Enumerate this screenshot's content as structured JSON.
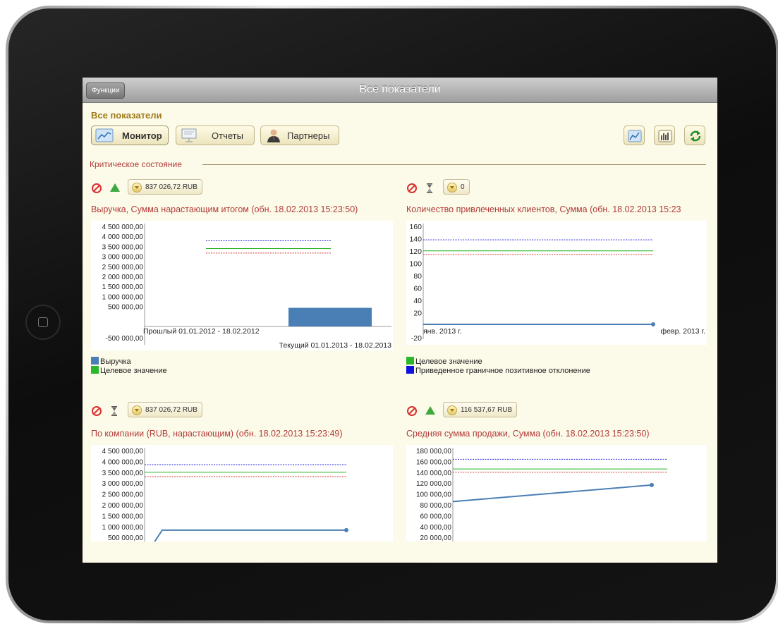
{
  "window": {
    "title": "Все показатели",
    "functions_button": "Функции"
  },
  "header": {
    "section_title": "Все показатели"
  },
  "nav": [
    {
      "label": "Монитор",
      "active": true,
      "icon": "monitor-chart-icon"
    },
    {
      "label": "Отчеты",
      "active": false,
      "icon": "presentation-board-icon"
    },
    {
      "label": "Партнеры",
      "active": false,
      "icon": "person-icon"
    }
  ],
  "toolbar_icons": [
    "line-chart-icon",
    "bar-chart-icon",
    "refresh-icon"
  ],
  "group": {
    "label": "Критическое состояние"
  },
  "colors": {
    "accent_red": "#b23a3a",
    "section_gold": "#a07a1a",
    "series_blue": "#4a7fb5",
    "target_green": "#2ab82a"
  },
  "indicators": [
    {
      "trend": "up",
      "trend_icon": "green-triangle-up-icon",
      "value": "837 026,72 RUB",
      "title": "Выручка, Сумма нарастающим итогом (обн. 18.02.2013 15:23:50)",
      "legend": [
        {
          "label": "Выручка",
          "color": "#4a7fb5"
        },
        {
          "label": "Целевое значение",
          "color": "#2ab82a"
        }
      ],
      "chart_data": {
        "type": "bar",
        "y_ticks": [
          "4 500 000,00",
          "4 000 000,00",
          "3 500 000,00",
          "3 000 000,00",
          "2 500 000,00",
          "2 000 000,00",
          "1 500 000,00",
          "1 000 000,00",
          "500 000,00",
          "-500 000,00"
        ],
        "ylim": [
          -500000,
          4500000
        ],
        "categories": [
          "Прошлый 01.01.2012 - 18.02.2012",
          "Текущий 01.01.2013 - 18.02.2013"
        ],
        "series": [
          {
            "name": "Выручка",
            "values": [
              0,
              837026.72
            ]
          }
        ],
        "reference_lines": [
          {
            "value": 3850000,
            "style": "dotted-blue"
          },
          {
            "value": 3500000,
            "style": "solid-green"
          },
          {
            "value": 3300000,
            "style": "dotted-red"
          }
        ]
      }
    },
    {
      "trend": "neutral",
      "trend_icon": "hourglass-icon",
      "value": "0",
      "title": "Количество привлеченных клиентов, Сумма (обн. 18.02.2013 15:23",
      "legend": [
        {
          "label": "Целевое значение",
          "color": "#2ab82a"
        },
        {
          "label": "Приведенное граничное позитивное отклонение",
          "color": "#1010e0"
        }
      ],
      "chart_data": {
        "type": "line",
        "y_ticks": [
          "160",
          "140",
          "120",
          "100",
          "80",
          "60",
          "40",
          "20",
          "-20"
        ],
        "ylim": [
          -20,
          160
        ],
        "x_labels": [
          "янв. 2013 г.",
          "февр. 2013 г."
        ],
        "series": [
          {
            "values": [
              0,
              0
            ]
          }
        ],
        "reference_lines": [
          {
            "value": 138,
            "style": "dotted-blue"
          },
          {
            "value": 120,
            "style": "solid-green"
          },
          {
            "value": 114,
            "style": "dotted-red"
          }
        ]
      }
    },
    {
      "trend": "neutral",
      "trend_icon": "hourglass-icon",
      "value": "837 026,72 RUB",
      "title": "По компании (RUB, нарастающим) (обн. 18.02.2013 15:23:49)",
      "chart_data": {
        "type": "line",
        "y_ticks": [
          "4 500 000,00",
          "4 000 000,00",
          "3 500 000,00",
          "3 000 000,00",
          "2 500 000,00",
          "2 000 000,00",
          "1 500 000,00",
          "1 000 000,00",
          "500 000,00"
        ],
        "ylim": [
          500000,
          4500000
        ],
        "series": [
          {
            "values": [
              0,
              837026.72,
              837026.72
            ]
          }
        ],
        "reference_lines": [
          {
            "value": 3850000,
            "style": "dotted-blue"
          },
          {
            "value": 3500000,
            "style": "solid-green"
          },
          {
            "value": 3300000,
            "style": "dotted-red"
          }
        ]
      }
    },
    {
      "trend": "up",
      "trend_icon": "green-triangle-up-icon",
      "value": "116 537,67 RUB",
      "title": "Средняя сумма продажи, Сумма (обн. 18.02.2013 15:23:50)",
      "chart_data": {
        "type": "line",
        "y_ticks": [
          "180 000,00",
          "160 000,00",
          "140 000,00",
          "120 000,00",
          "100 000,00",
          "80 000,00",
          "60 000,00",
          "40 000,00",
          "20 000,00"
        ],
        "ylim": [
          20000,
          180000
        ],
        "series": [
          {
            "values": [
              86000,
              116537.67
            ]
          }
        ],
        "reference_lines": [
          {
            "value": 164000,
            "style": "dotted-blue"
          },
          {
            "value": 146000,
            "style": "solid-green"
          },
          {
            "value": 140000,
            "style": "dotted-red"
          }
        ]
      }
    }
  ]
}
